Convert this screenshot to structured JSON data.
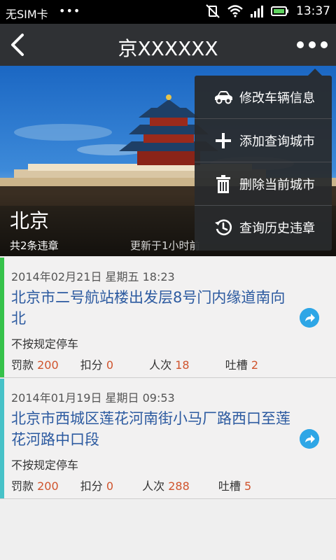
{
  "status_bar": {
    "carrier": "无SIM卡",
    "dots": "•••",
    "time": "13:37"
  },
  "app_bar": {
    "title": "京XXXXXX"
  },
  "hero": {
    "city": "北京",
    "violation_count": "共2条违章",
    "updated": "更新于1小时前"
  },
  "menu": {
    "items": [
      {
        "label": "修改车辆信息",
        "icon": "car-icon"
      },
      {
        "label": "添加查询城市",
        "icon": "plus-icon"
      },
      {
        "label": "删除当前城市",
        "icon": "trash-icon"
      },
      {
        "label": "查询历史违章",
        "icon": "history-icon"
      }
    ]
  },
  "records": [
    {
      "datetime": "2014年02月21日 星期五 18:23",
      "address": "北京市二号航站楼出发层8号门内缘道南向北",
      "violation": "不按规定停车",
      "fine_label": "罚款",
      "fine": "200",
      "points_label": "扣分",
      "points": "0",
      "people_label": "人次",
      "people": "18",
      "comments_label": "吐槽",
      "comments": "2",
      "accent": "#36c24a"
    },
    {
      "datetime": "2014年01月19日 星期日 09:53",
      "address": "北京市西城区莲花河南街小马厂路西口至莲花河路中口段",
      "violation": "不按规定停车",
      "fine_label": "罚款",
      "fine": "200",
      "points_label": "扣分",
      "points": "0",
      "people_label": "人次",
      "people": "288",
      "comments_label": "吐槽",
      "comments": "5",
      "accent": "#47c2c8"
    }
  ],
  "colors": {
    "appbar": "#2f3134",
    "link_blue": "#2c5aa0",
    "value_red": "#d0542d",
    "share_blue": "#2ea6e6"
  }
}
